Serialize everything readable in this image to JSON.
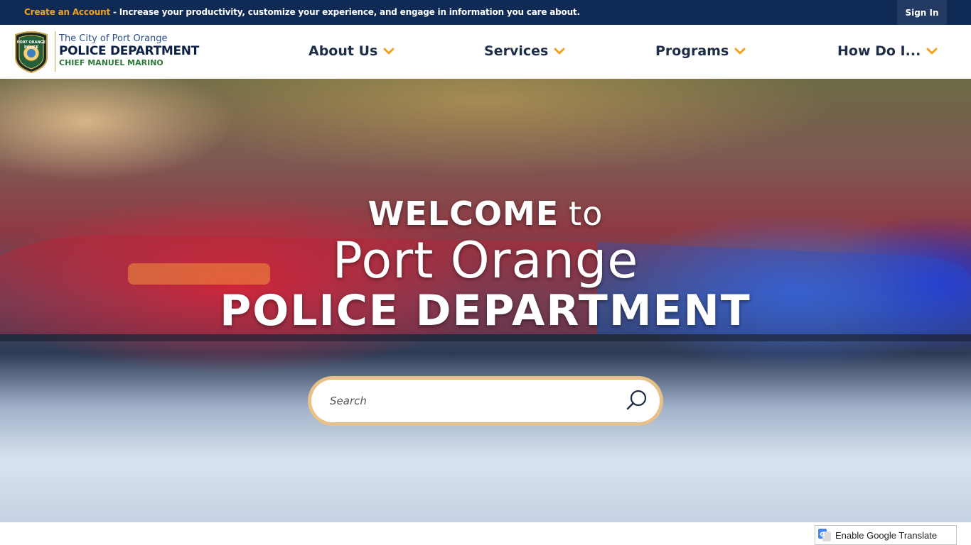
{
  "topbar": {
    "create_account": "Create an Account",
    "promo_text": " - Increase your productivity, customize your experience, and engage in information you care about.",
    "sign_in": "Sign In"
  },
  "header": {
    "logo_line1": "The City of Port Orange",
    "logo_line2": "POLICE DEPARTMENT",
    "logo_line3": "CHIEF MANUEL MARINO",
    "badge_text_top": "PORT ORANGE",
    "badge_text_mid": "POLICE"
  },
  "nav": {
    "items": [
      {
        "label": "About Us",
        "icon": "chevron-down-icon"
      },
      {
        "label": "Services",
        "icon": "chevron-down-icon"
      },
      {
        "label": "Programs",
        "icon": "chevron-down-icon"
      },
      {
        "label": "How Do I...",
        "icon": "chevron-down-icon"
      }
    ]
  },
  "hero": {
    "welcome": "WELCOME",
    "to": "to",
    "city": "Port Orange",
    "department": "POLICE DEPARTMENT"
  },
  "search": {
    "placeholder": "Search",
    "icon": "search-icon"
  },
  "translate": {
    "label": "Enable Google Translate",
    "icon": "google-translate-icon"
  },
  "colors": {
    "topbar_bg": "#0e2a55",
    "accent_orange": "#f3a21c",
    "nav_text": "#1f2e48",
    "search_ring": "#e8c08a"
  }
}
